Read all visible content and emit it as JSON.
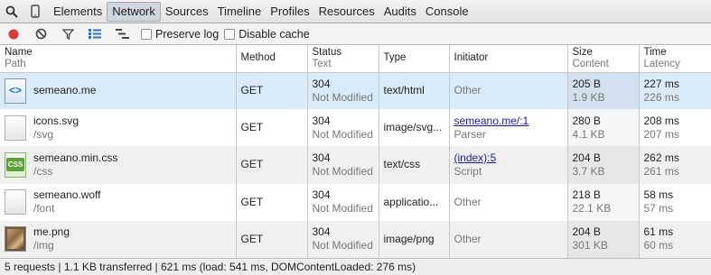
{
  "tabs": [
    "Elements",
    "Network",
    "Sources",
    "Timeline",
    "Profiles",
    "Resources",
    "Audits",
    "Console"
  ],
  "active_tab": "Network",
  "toolbar": {
    "preserve_log": "Preserve log",
    "disable_cache": "Disable cache",
    "record_color": "#d93a3a"
  },
  "columns": {
    "name": "Name",
    "name_sub": "Path",
    "method": "Method",
    "status": "Status",
    "status_sub": "Text",
    "type": "Type",
    "initiator": "Initiator",
    "size": "Size",
    "size_sub": "Content",
    "time": "Time",
    "time_sub": "Latency"
  },
  "rows": [
    {
      "icon": "html-file-icon",
      "name": "semeano.me",
      "path": "",
      "method": "GET",
      "status": "304",
      "status_text": "Not Modified",
      "type": "text/html",
      "initiator": "Other",
      "initiator_sub": "",
      "size": "205 B",
      "content": "1.9 KB",
      "time": "227 ms",
      "latency": "226 ms"
    },
    {
      "icon": "generic-file-icon",
      "name": "icons.svg",
      "path": "/svg",
      "method": "GET",
      "status": "304",
      "status_text": "Not Modified",
      "type": "image/svg...",
      "initiator": "semeano.me/:1",
      "initiator_sub": "Parser",
      "size": "280 B",
      "content": "4.1 KB",
      "time": "208 ms",
      "latency": "207 ms"
    },
    {
      "icon": "css-file-icon",
      "name": "semeano.min.css",
      "path": "/css",
      "method": "GET",
      "status": "304",
      "status_text": "Not Modified",
      "type": "text/css",
      "initiator": "(index):5",
      "initiator_sub": "Script",
      "size": "204 B",
      "content": "3.7 KB",
      "time": "262 ms",
      "latency": "261 ms"
    },
    {
      "icon": "generic-file-icon",
      "name": "semeano.woff",
      "path": "/font",
      "method": "GET",
      "status": "304",
      "status_text": "Not Modified",
      "type": "applicatio...",
      "initiator": "Other",
      "initiator_sub": "",
      "size": "218 B",
      "content": "22.1 KB",
      "time": "58 ms",
      "latency": "57 ms"
    },
    {
      "icon": "image-thumbnail-icon",
      "name": "me.png",
      "path": "/img",
      "method": "GET",
      "status": "304",
      "status_text": "Not Modified",
      "type": "image/png",
      "initiator": "Other",
      "initiator_sub": "",
      "size": "204 B",
      "content": "301 KB",
      "time": "61 ms",
      "latency": "60 ms"
    }
  ],
  "status_bar": "5 requests | 1.1 KB transferred | 621 ms (load: 541 ms, DOMContentLoaded: 276 ms)"
}
